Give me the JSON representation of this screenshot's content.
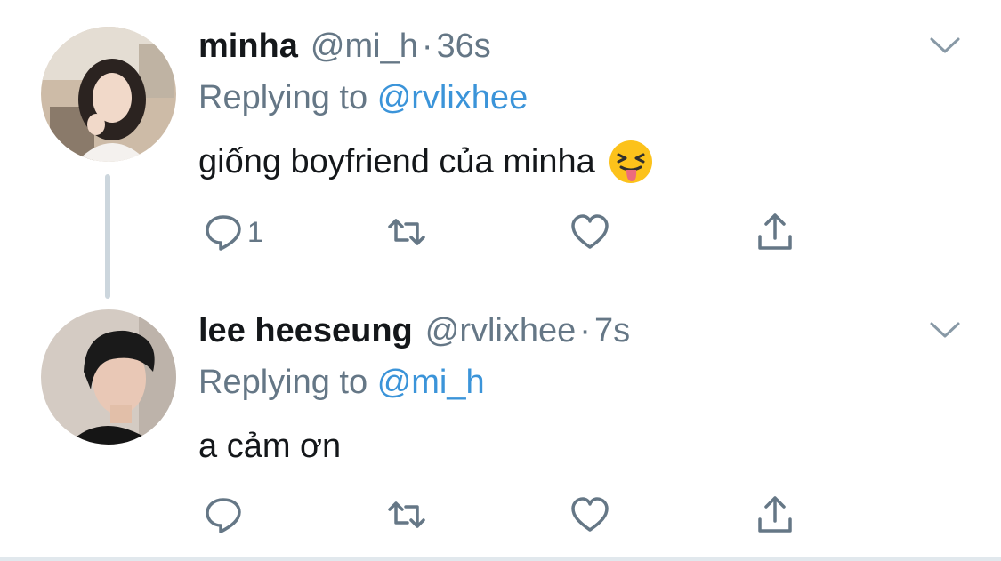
{
  "tweets": [
    {
      "name": "minha",
      "handle": "@mi_h",
      "separator": "·",
      "time": "36s",
      "replying_prefix": "Replying to",
      "replying_to": "@rvlixhee",
      "text": "giống boyfriend của minha",
      "emoji": "squinting-face-with-tongue",
      "reply_count": "1"
    },
    {
      "name": "lee heeseung",
      "handle": "@rvlixhee",
      "separator": "·",
      "time": "7s",
      "replying_prefix": "Replying to",
      "replying_to": "@mi_h",
      "text": "a cảm ơn",
      "reply_count": ""
    }
  ],
  "colors": {
    "secondary_text": "#657786",
    "mention": "#3b94d9",
    "thread_line": "#ccd6dd",
    "icon": "#657786"
  }
}
